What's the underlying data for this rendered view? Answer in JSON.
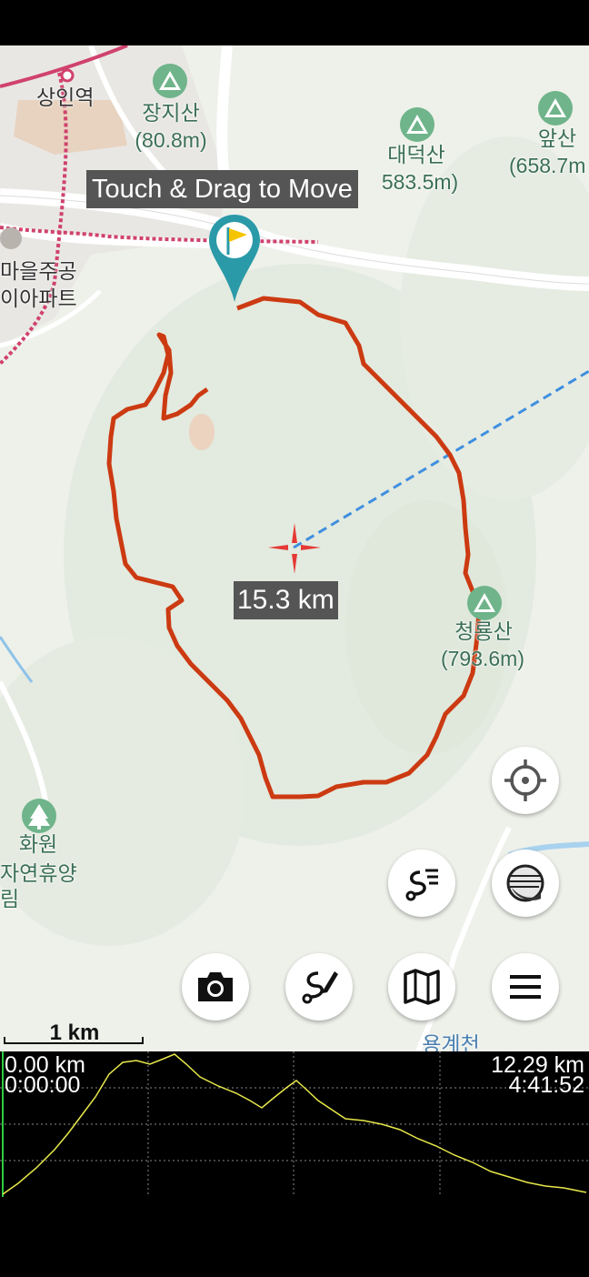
{
  "map": {
    "drag_hint": "Touch & Drag to Move",
    "distance_label": "15.3 km",
    "scale_label": "1 km",
    "places": {
      "station": "상인역",
      "peak1_name": "장지산",
      "peak1_height": "(80.8m)",
      "peak2_name": "대덕산",
      "peak2_height": "583.5m)",
      "peak3_name": "앞산",
      "peak3_height": "(658.7m",
      "apartment_line1": "마을주공",
      "apartment_line2": "이아파트",
      "peak4_name": "청룡산",
      "peak4_height": "(793.6m)",
      "forest_line1": "화원",
      "forest_line2": "자연휴양림",
      "stream": "용계천"
    },
    "colors": {
      "track": "#cc3a12",
      "direction_line": "#3f8fe0",
      "marker": "#2b9aa8",
      "flag": "#f5c400",
      "crosshair": "#e53935"
    }
  },
  "controls": {
    "locate": "crosshair-icon",
    "track_list": "track-list-icon",
    "layers": "layers-icon",
    "camera": "camera-icon",
    "route_edit": "route-edit-icon",
    "map": "map-icon",
    "menu": "menu-icon"
  },
  "profile": {
    "start_distance": "0.00 km",
    "start_time": "0:00:00",
    "end_distance": "12.29 km",
    "end_time": "4:41:52",
    "line_color": "#e8e84a"
  }
}
